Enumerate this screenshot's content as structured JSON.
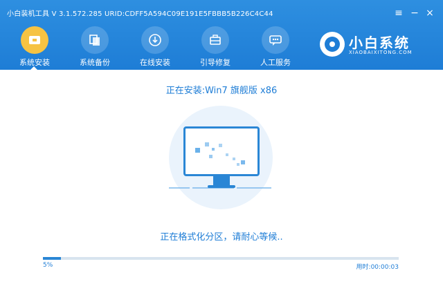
{
  "window": {
    "title": "小白装机工具 V 3.1.572.285 URID:CDFF5A594C09E191E5FBBB5B226C4C44"
  },
  "nav": {
    "items": [
      {
        "label": "系统安装",
        "icon": "install-icon",
        "active": true
      },
      {
        "label": "系统备份",
        "icon": "backup-icon",
        "active": false
      },
      {
        "label": "在线安装",
        "icon": "online-icon",
        "active": false
      },
      {
        "label": "引导修复",
        "icon": "repair-icon",
        "active": false
      },
      {
        "label": "人工服务",
        "icon": "support-icon",
        "active": false
      }
    ]
  },
  "brand": {
    "name": "小白系统",
    "url": "XIAOBAIXITONG.COM"
  },
  "main": {
    "status_title": "正在安装:Win7 旗舰版 x86",
    "status_message": "正在格式化分区，请耐心等候..",
    "progress_label": "5%",
    "progress_value": 0.05,
    "elapsed": "用时:00:00:03"
  },
  "colors": {
    "accent": "#1e7dd6",
    "active_tab": "#f6c343"
  }
}
